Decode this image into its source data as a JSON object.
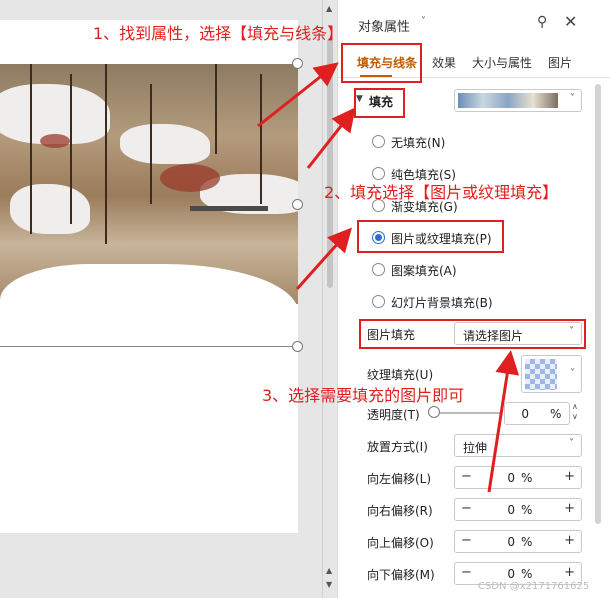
{
  "panel": {
    "title": "对象属性",
    "tabs": [
      "填充与线条",
      "效果",
      "大小与属性",
      "图片"
    ],
    "fill_section": "填充",
    "fill_options": [
      "无填充(N)",
      "纯色填充(S)",
      "渐变填充(G)",
      "图片或纹理填充(P)",
      "图案填充(A)",
      "幻灯片背景填充(B)"
    ],
    "selected_option": "图片或纹理填充(P)",
    "picture_fill": {
      "label": "图片填充",
      "value": "请选择图片"
    },
    "texture_fill": {
      "label": "纹理填充(U)"
    },
    "transparency": {
      "label": "透明度(T)",
      "value": "0",
      "unit": "%"
    },
    "placement": {
      "label": "放置方式(I)",
      "value": "拉伸"
    },
    "offsets": [
      {
        "label": "向左偏移(L)",
        "value": "0",
        "unit": "%"
      },
      {
        "label": "向右偏移(R)",
        "value": "0",
        "unit": "%"
      },
      {
        "label": "向上偏移(O)",
        "value": "0",
        "unit": "%"
      },
      {
        "label": "向下偏移(M)",
        "value": "0",
        "unit": "%"
      }
    ]
  },
  "annotations": {
    "step1": "1、找到属性，选择【填充与线条】",
    "step2": "2、填充选择【图片或纹理填充】",
    "step3": "3、选择需要填充的图片即可"
  },
  "watermark": "CSDN @x2171761625",
  "colors": {
    "accent": "#c25b00",
    "annotation_red": "#e02020",
    "radio_blue": "#2c6fd1"
  }
}
